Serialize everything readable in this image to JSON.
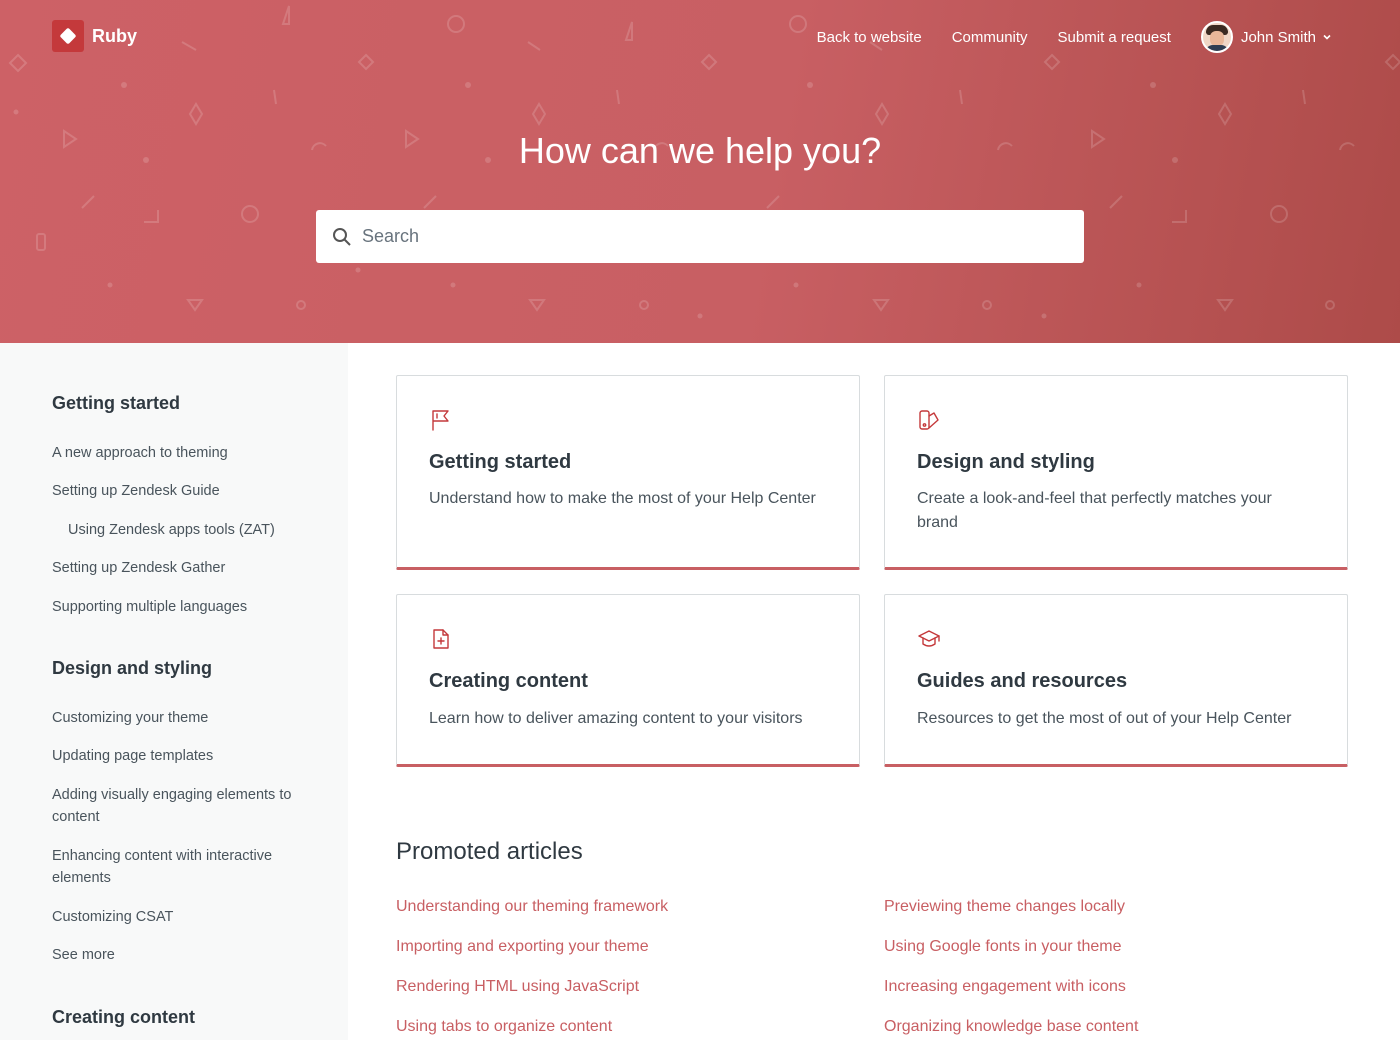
{
  "brand": {
    "name": "Ruby",
    "accent": "#c4393b"
  },
  "nav": {
    "back_to_website": "Back to website",
    "community": "Community",
    "submit_request": "Submit a request",
    "user_name": "John Smith"
  },
  "hero": {
    "title": "How can we help you?",
    "search_placeholder": "Search"
  },
  "sidebar": {
    "groups": [
      {
        "title": "Getting started",
        "items": [
          "A new approach to theming",
          "Setting up Zendesk Guide",
          "Using Zendesk apps tools (ZAT)",
          "Setting up Zendesk Gather",
          "Supporting multiple languages"
        ]
      },
      {
        "title": "Design and styling",
        "items": [
          "Customizing your theme",
          "Updating page templates",
          "Adding visually engaging elements to content",
          "Enhancing content with interactive elements",
          "Customizing CSAT",
          "See more"
        ]
      },
      {
        "title": "Creating content",
        "items": []
      }
    ]
  },
  "categories": [
    {
      "title": "Getting started",
      "description": "Understand how to make the most of your Help Center",
      "icon": "flag-icon"
    },
    {
      "title": "Design and styling",
      "description": "Create a look-and-feel that perfectly matches your brand",
      "icon": "palette-icon"
    },
    {
      "title": "Creating content",
      "description": "Learn how to deliver amazing content to your visitors",
      "icon": "file-add-icon"
    },
    {
      "title": "Guides and resources",
      "description": "Resources to get the most of out of your Help Center",
      "icon": "graduation-cap-icon"
    }
  ],
  "promoted": {
    "title": "Promoted articles",
    "left": [
      "Understanding our theming framework",
      "Importing and exporting your theme",
      "Rendering HTML using JavaScript",
      "Using tabs to organize content"
    ],
    "right": [
      "Previewing theme changes locally",
      "Using Google fonts in your theme",
      "Increasing engagement with icons",
      "Organizing knowledge base content"
    ]
  }
}
